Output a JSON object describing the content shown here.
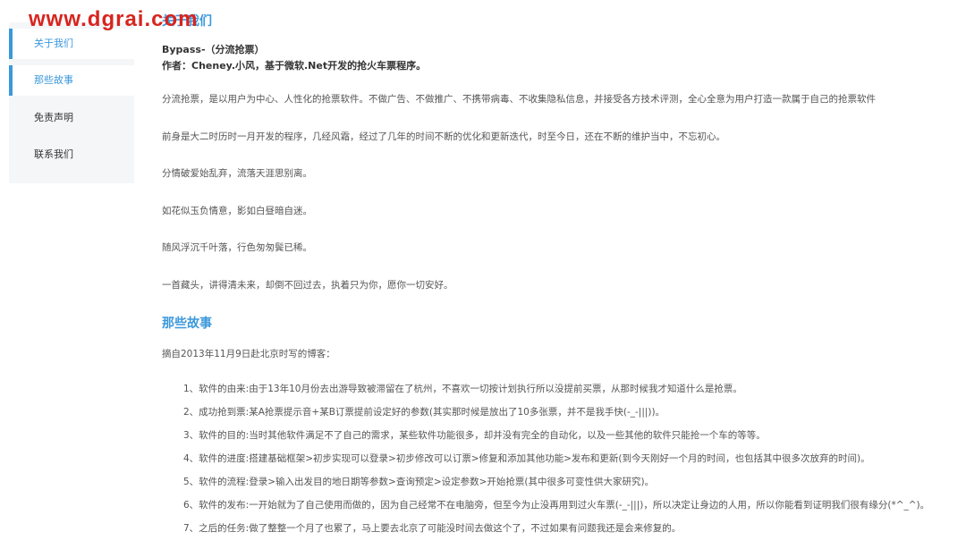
{
  "watermark": "www.dgrai.com",
  "sidebar": {
    "items": [
      {
        "label": "关于我们"
      },
      {
        "label": "那些故事"
      },
      {
        "label": "免责声明"
      },
      {
        "label": "联系我们"
      }
    ]
  },
  "about": {
    "heading": "关于我们",
    "title_line": "Bypass-（分流抢票）",
    "author_line": "作者：Cheney.小风，基于微软.Net开发的抢火车票程序。",
    "paragraphs": [
      "分流抢票，是以用户为中心、人性化的抢票软件。不做广告、不做推广、不携带病毒、不收集隐私信息，并接受各方技术评测，全心全意为用户打造一款属于自己的抢票软件",
      "前身是大二时历时一月开发的程序，几经风霜，经过了几年的时间不断的优化和更新迭代，时至今日，还在不断的维护当中，不忘初心。",
      "分情破爱始乱弃，流落天涯思别离。",
      "如花似玉负情意，影如白昼暗自迷。",
      "随风浮沉千叶落，行色匆匆鬓已稀。",
      "一首藏头，讲得清未来，却倒不回过去，执着只为你，愿你一切安好。"
    ]
  },
  "stories": {
    "heading": "那些故事",
    "intro": "摘自2013年11月9日赴北京时写的博客：",
    "items": [
      "1、软件的由来:由于13年10月份去出游导致被滞留在了杭州，不喜欢一切按计划执行所以没提前买票，从那时候我才知道什么是抢票。",
      "2、成功抢到票:某A抢票提示音+某B订票提前设定好的参数(其实那时候是放出了10多张票，并不是我手快(-_-|||))。",
      "3、软件的目的:当时其他软件满足不了自己的需求，某些软件功能很多，却并没有完全的自动化，以及一些其他的软件只能抢一个车的等等。",
      "4、软件的进度:搭建基础框架>初步实现可以登录>初步修改可以订票>修复和添加其他功能>发布和更新(到今天刚好一个月的时间，也包括其中很多次放弃的时间)。",
      "5、软件的流程:登录>输入出发目的地日期等参数>查询预定>设定参数>开始抢票(其中很多可变性供大家研究)。",
      "6、软件的发布:一开始就为了自己使用而做的，因为自己经常不在电脑旁，但至今为止没再用到过火车票(-_-|||)，所以决定让身边的人用，所以你能看到证明我们很有缘分(*^_^)。",
      "7、之后的任务:做了整整一个月了也累了，马上要去北京了可能没时间去做这个了，不过如果有问题我还是会来修复的。"
    ]
  },
  "colors": {
    "accent": "#3b98db",
    "watermark": "#d8241f"
  }
}
